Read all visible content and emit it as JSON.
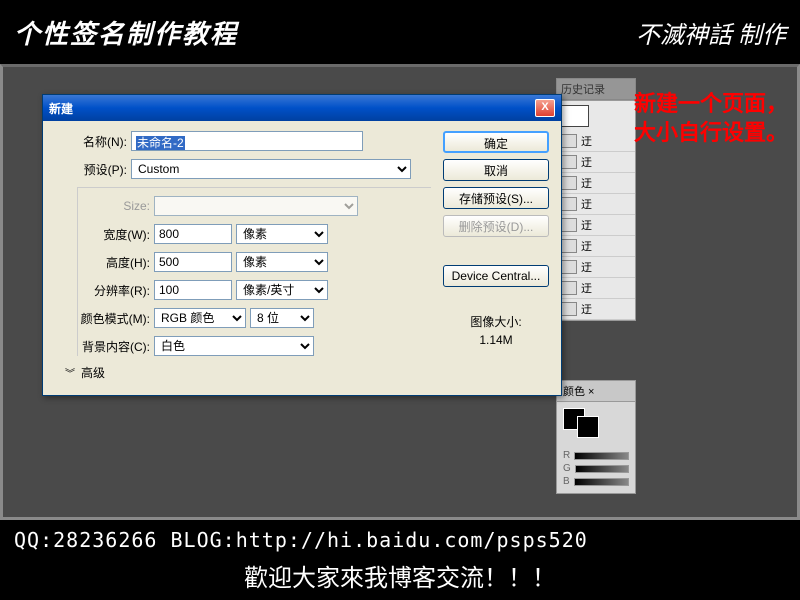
{
  "banner": {
    "title": "个性签名制作教程",
    "logo": "不滅神話 制作"
  },
  "annotation": "新建一个页面，大小自行设置。",
  "history_panel": {
    "tab": "历史记录"
  },
  "color_panel": {
    "tab": "颜色 ×",
    "channels": [
      "R",
      "G",
      "B"
    ]
  },
  "dialog": {
    "title": "新建",
    "close": "X",
    "labels": {
      "name": "名称(N):",
      "preset": "预设(P):",
      "size": "Size:",
      "width": "宽度(W):",
      "height": "高度(H):",
      "resolution": "分辨率(R):",
      "color_mode": "颜色模式(M):",
      "bg_content": "背景内容(C):",
      "advanced": "高级"
    },
    "values": {
      "name": "未命名-2",
      "preset": "Custom",
      "size": "",
      "width": "800",
      "height": "500",
      "resolution": "100",
      "color_mode": "RGB 颜色",
      "bit_depth": "8 位",
      "bg_content": "白色"
    },
    "units": {
      "width": "像素",
      "height": "像素",
      "resolution": "像素/英寸"
    },
    "buttons": {
      "ok": "确定",
      "cancel": "取消",
      "save_preset": "存储预设(S)...",
      "delete_preset": "删除预设(D)...",
      "device_central": "Device Central..."
    },
    "info": {
      "label": "图像大小:",
      "value": "1.14M"
    }
  },
  "footer": {
    "line1": "QQ:28236266  BLOG:http://hi.baidu.com/psps520",
    "line2": "歡迎大家來我博客交流！！！"
  }
}
